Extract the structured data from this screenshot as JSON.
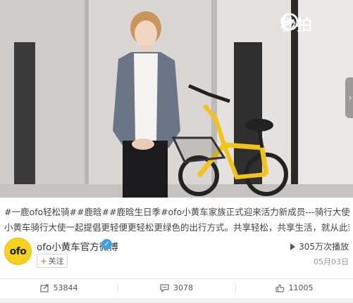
{
  "video": {
    "watermark_text": "秒拍",
    "watermark_icon": "camera-lens-icon",
    "side_arrow": "›"
  },
  "caption": {
    "line1": "#一鹿ofo轻松骑##鹿晗##鹿晗生日季#ofo小黄车家族正式迎来活力新成员---骑行大使@M鹿M 。让我们和ofo",
    "line2": "小黄车骑行大使一起提倡更轻便更轻松更绿色的出行方式。共享轻松，共享生活，就从此刻开始，让我们..."
  },
  "author": {
    "avatar_text": "ofo",
    "name": "ofo小黄车官方微博",
    "verified_icon": "verified-v-icon",
    "follow_label": "关注",
    "follow_plus": "+"
  },
  "stats": {
    "play_count": "305万次播放",
    "date": "05月03日"
  },
  "actions": {
    "repost_count": "53844",
    "comment_count": "3078",
    "like_count": "11005"
  },
  "colors": {
    "brand_yellow": "#f5d31c",
    "link_orange": "#eb7350",
    "verified_blue": "#3ea0e6"
  }
}
